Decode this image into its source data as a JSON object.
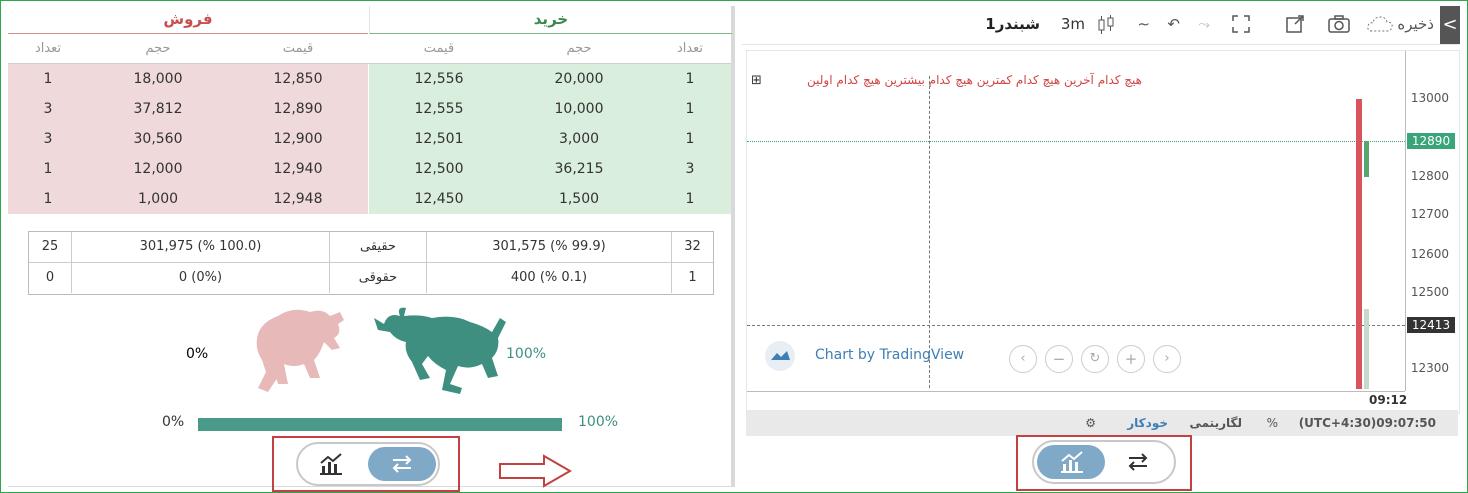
{
  "orderbook": {
    "sell_title": "فروش",
    "buy_title": "خرید",
    "col_count": "تعداد",
    "col_volume": "حجم",
    "col_price": "قیمت",
    "rows": [
      {
        "sell_count": "1",
        "sell_volume": "18,000",
        "sell_price": "12,850",
        "buy_price": "12,556",
        "buy_volume": "20,000",
        "buy_count": "1"
      },
      {
        "sell_count": "3",
        "sell_volume": "37,812",
        "sell_price": "12,890",
        "buy_price": "12,555",
        "buy_volume": "10,000",
        "buy_count": "1"
      },
      {
        "sell_count": "3",
        "sell_volume": "30,560",
        "sell_price": "12,900",
        "buy_price": "12,501",
        "buy_volume": "3,000",
        "buy_count": "1"
      },
      {
        "sell_count": "1",
        "sell_volume": "12,000",
        "sell_price": "12,940",
        "buy_price": "12,500",
        "buy_volume": "36,215",
        "buy_count": "3"
      },
      {
        "sell_count": "1",
        "sell_volume": "1,000",
        "sell_price": "12,948",
        "buy_price": "12,450",
        "buy_volume": "1,500",
        "buy_count": "1"
      }
    ]
  },
  "summary": {
    "rows": [
      {
        "sell_count": "25",
        "sell_value": "301,975 (% 100.0)",
        "label": "حقیقی",
        "buy_value": "301,575 (% 99.9)",
        "buy_count": "32"
      },
      {
        "sell_count": "0",
        "sell_value": "0 (0%)",
        "label": "حقوقی",
        "buy_value": "400 (% 0.1)",
        "buy_count": "1"
      }
    ]
  },
  "sentiment": {
    "bear_pct": "0%",
    "bull_pct": "100%",
    "bar_left": "0%",
    "bar_right": "100%",
    "buy_fraction": 1.0,
    "bear_color": "#e8b9b9",
    "bull_color": "#3f8f80"
  },
  "chart": {
    "save_label": "ذخیره",
    "symbol": "شبندر1",
    "interval": "3m",
    "legend": "هیچ کدام آخرین  هیچ کدام کمترین  هیچ کدام بیشترین  هیچ کدام اولین",
    "price_levels": [
      "13000",
      "12800",
      "12700",
      "12600",
      "12500",
      "12300"
    ],
    "last_price": "12890",
    "cross_price": "12413",
    "time_label": "09:12",
    "watermark": "Chart by TradingView",
    "status_time": "(UTC+4:30)09:07:50",
    "status_pct": "%",
    "status_log": "لگاریتمی",
    "status_auto": "خودکار"
  },
  "colors": {
    "accent_green": "#2aa84a",
    "sell_bg": "#efd9db",
    "buy_bg": "#d9eedd",
    "toggle_active": "#7fa9c7",
    "highlight_red": "#c24141"
  }
}
